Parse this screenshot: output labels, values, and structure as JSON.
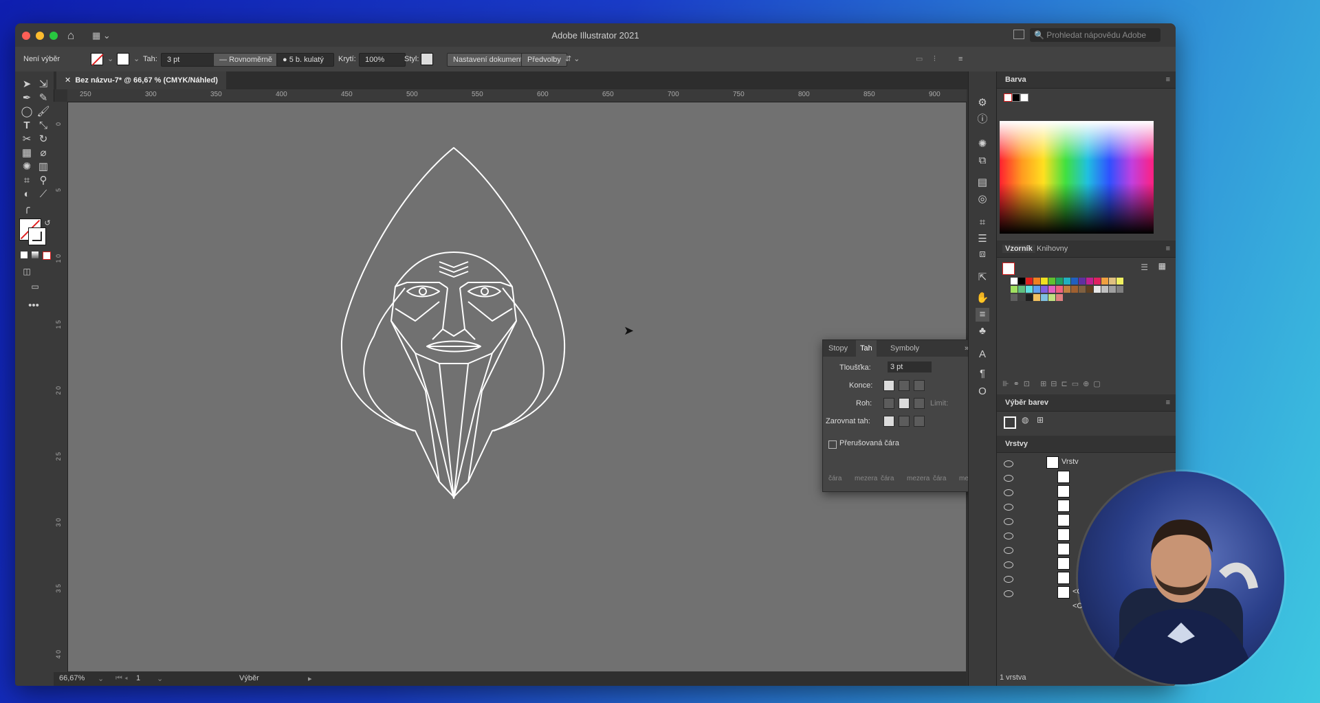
{
  "window": {
    "title": "Adobe Illustrator 2021",
    "search_placeholder": "Prohledat nápovědu Adobe"
  },
  "control_bar": {
    "selection_status": "Není výběr",
    "stroke_label": "Tah:",
    "stroke_weight": "3 pt",
    "stroke_profile": "Rovnoměrně",
    "brush": "5 b. kulatý",
    "opacity_label": "Krytí:",
    "opacity": "100%",
    "style_label": "Styl:",
    "doc_setup_button": "Nastavení dokumentu",
    "prefs_button": "Předvolby"
  },
  "document": {
    "tab_title": "Bez názvu-7* @ 66,67 % (CMYK/Náhled)",
    "ruler_h": [
      "250",
      "300",
      "350",
      "400",
      "450",
      "500",
      "550",
      "600",
      "650",
      "700",
      "750",
      "800",
      "850",
      "900"
    ],
    "ruler_v": [
      "0",
      "5",
      "1 0",
      "1 5",
      "2 0",
      "2 5",
      "3 0",
      "3 5",
      "4 0"
    ]
  },
  "status_bar": {
    "zoom": "66,67%",
    "artboard": "1",
    "tool": "Výběr"
  },
  "stroke_panel": {
    "tabs": [
      "Stopy",
      "Tah",
      "Symboly"
    ],
    "weight_label": "Tloušťka:",
    "weight_value": "3 pt",
    "cap_label": "Konce:",
    "corner_label": "Roh:",
    "limit_label": "Limit:",
    "align_label": "Zarovnat tah:",
    "dashed_label": "Přerušovaná čára",
    "dash_labels": [
      "čára",
      "mezera",
      "čára",
      "mezera",
      "čára",
      "mezera"
    ]
  },
  "panels": {
    "color": "Barva",
    "swatches_tab": "Vzorník",
    "libraries_tab": "Knihovny",
    "color_picker": "Výběr barev",
    "layers": "Vrstvy",
    "layer_name": "Vrstv",
    "layer_items": [
      "<Ce...",
      "<Ces..."
    ],
    "layers_count": "1 vrstva"
  },
  "colors": {
    "app_bg": "#323232",
    "canvas": "#717171",
    "artwork_stroke": "#ffffff"
  }
}
